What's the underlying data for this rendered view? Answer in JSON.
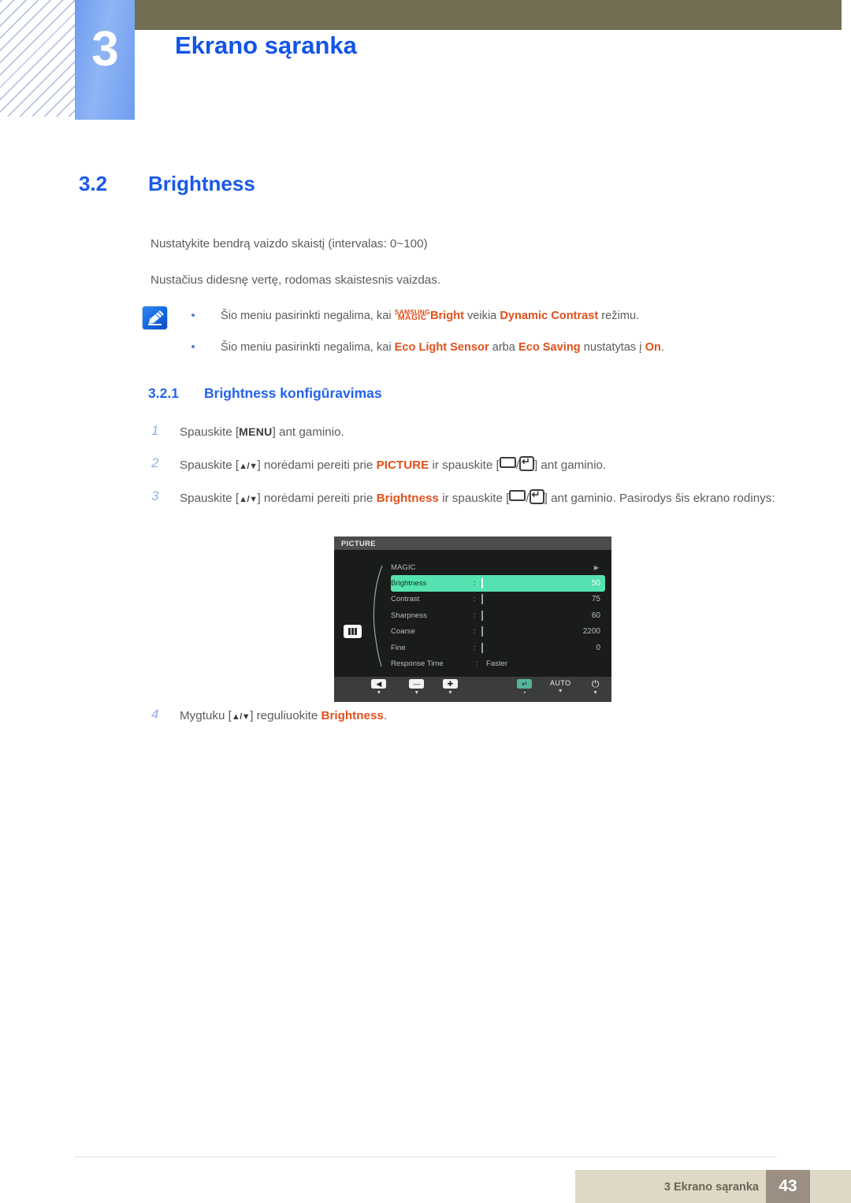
{
  "header": {
    "chapter_number": "3",
    "chapter_title": "Ekrano sąranka"
  },
  "section": {
    "number": "3.2",
    "title": "Brightness"
  },
  "intro": {
    "p1": "Nustatykite bendrą vaizdo skaistį (intervalas: 0~100)",
    "p2": "Nustačius didesnę vertę, rodomas skaistesnis vaizdas."
  },
  "note": {
    "icon": "note-pen-icon",
    "items": [
      {
        "prefix": "Šio meniu pasirinkti negalima, kai ",
        "badge_line1": "SAMSUNG",
        "badge_line2": "MAGIC",
        "badge_word": "Bright",
        "mid": " veikia ",
        "highlight": "Dynamic Contrast",
        "suffix": " režimu."
      },
      {
        "prefix": "Šio meniu pasirinkti negalima, kai ",
        "highlight1": "Eco Light Sensor",
        "mid": " arba ",
        "highlight2": "Eco Saving",
        "mid2": " nustatytas į ",
        "highlight3": "On",
        "suffix": "."
      }
    ]
  },
  "subsection": {
    "number": "3.2.1",
    "title": "Brightness konfigūravimas"
  },
  "steps": [
    {
      "num": "1",
      "a": "Spauskite [",
      "key": "MENU",
      "b": "] ant gaminio."
    },
    {
      "num": "2",
      "a": "Spauskite [",
      "arrows": "▲/▼",
      "b": "] norėdami pereiti prie ",
      "highlight": "PICTURE",
      "c": " ir spauskite [",
      "sep": "/",
      "d": "] ant gaminio."
    },
    {
      "num": "3",
      "a": "Spauskite [",
      "arrows": "▲/▼",
      "b": "] norėdami pereiti prie ",
      "highlight": "Brightness",
      "c": " ir spauskite [",
      "sep": "/",
      "d": "] ant gaminio. Pasirodys šis ekrano rodinys:"
    }
  ],
  "step4": {
    "num": "4",
    "a": "Mygtuku [",
    "arrows": "▲/▼",
    "b": "] reguliuokite ",
    "highlight": "Brightness",
    "c": "."
  },
  "osd": {
    "title": "PICTURE",
    "mode_icon": "picture-mode-icon",
    "rows": [
      {
        "label": "MAGIC",
        "type": "submenu",
        "caret": "▶"
      },
      {
        "label": "Brightness",
        "type": "slider",
        "value": "50",
        "fill_pct": 50,
        "active": true
      },
      {
        "label": "Contrast",
        "type": "slider",
        "value": "75",
        "fill_pct": 75,
        "active": false
      },
      {
        "label": "Sharpness",
        "type": "slider",
        "value": "60",
        "fill_pct": 60,
        "active": false
      },
      {
        "label": "Coarse",
        "type": "slider",
        "value": "2200",
        "fill_pct": 48,
        "active": false
      },
      {
        "label": "Fine",
        "type": "slider",
        "value": "0",
        "fill_pct": 0,
        "active": false
      },
      {
        "label": "Response Time",
        "type": "text",
        "value": "Faster",
        "active": false
      }
    ],
    "footer_buttons": [
      {
        "name": "back-button",
        "glyph": "◀",
        "kind": "cap"
      },
      {
        "name": "minus-button",
        "glyph": "—",
        "kind": "cap"
      },
      {
        "name": "plus-button",
        "glyph": "✚",
        "kind": "cap"
      },
      {
        "name": "enter-button",
        "glyph": "↵",
        "kind": "cap-teal"
      },
      {
        "name": "auto-button",
        "glyph": "AUTO",
        "kind": "text"
      },
      {
        "name": "power-button",
        "glyph": "⏻",
        "kind": "power"
      }
    ]
  },
  "footer": {
    "text": "3 Ekrano sąranka",
    "page": "43"
  }
}
